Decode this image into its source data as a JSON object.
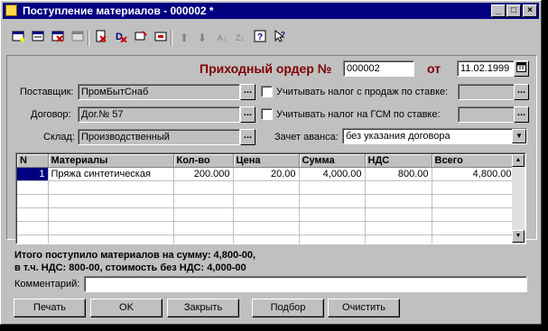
{
  "window": {
    "title": "Поступление материалов - 000002 *"
  },
  "toolbar": {
    "icons": [
      "new-row-icon",
      "copy-row-icon",
      "delete-row-icon",
      "edit-row-icon",
      "mark-delete-icon",
      "delete-icon",
      "edit-item-icon",
      "insert-item-icon",
      "move-up-icon",
      "move-down-icon",
      "sort-asc-icon",
      "sort-desc-icon",
      "help-icon",
      "context-help-icon"
    ]
  },
  "header": {
    "order_title": "Приходный ордер №",
    "order_number": "000002",
    "from_label": "от",
    "date": "11.02.1999"
  },
  "supplier": {
    "label": "Поставщик:",
    "value": "ПромБытСнаб"
  },
  "contract": {
    "label": "Договор:",
    "value": "Дог.№ 57"
  },
  "warehouse": {
    "label": "Склад:",
    "value": "Производственный"
  },
  "tax_sales": {
    "label": "Учитывать налог с продаж по ставке:",
    "checked": false,
    "value": ""
  },
  "tax_gsm": {
    "label": "Учитывать налог на ГСМ по ставке:",
    "checked": false,
    "value": ""
  },
  "advance": {
    "label": "Зачет аванса:",
    "value": "без указания договора"
  },
  "table": {
    "columns": [
      "N",
      "Материалы",
      "Кол-во",
      "Цена",
      "Сумма",
      "НДС",
      "Всего"
    ],
    "rows": [
      [
        "1",
        "Пряжа синтетическая",
        "200.000",
        "20.00",
        "4,000.00",
        "800.00",
        "4,800.00"
      ]
    ]
  },
  "summary": {
    "line1": "Итого поступило материалов на сумму: 4,800-00,",
    "line2": "в т.ч. НДС: 800-00, стоимость без НДС: 4,000-00"
  },
  "comment": {
    "label": "Комментарий:",
    "value": ""
  },
  "buttons": {
    "print": "Печать",
    "ok": "OK",
    "close": "Закрыть",
    "select": "Подбор",
    "clear": "Очистить"
  }
}
